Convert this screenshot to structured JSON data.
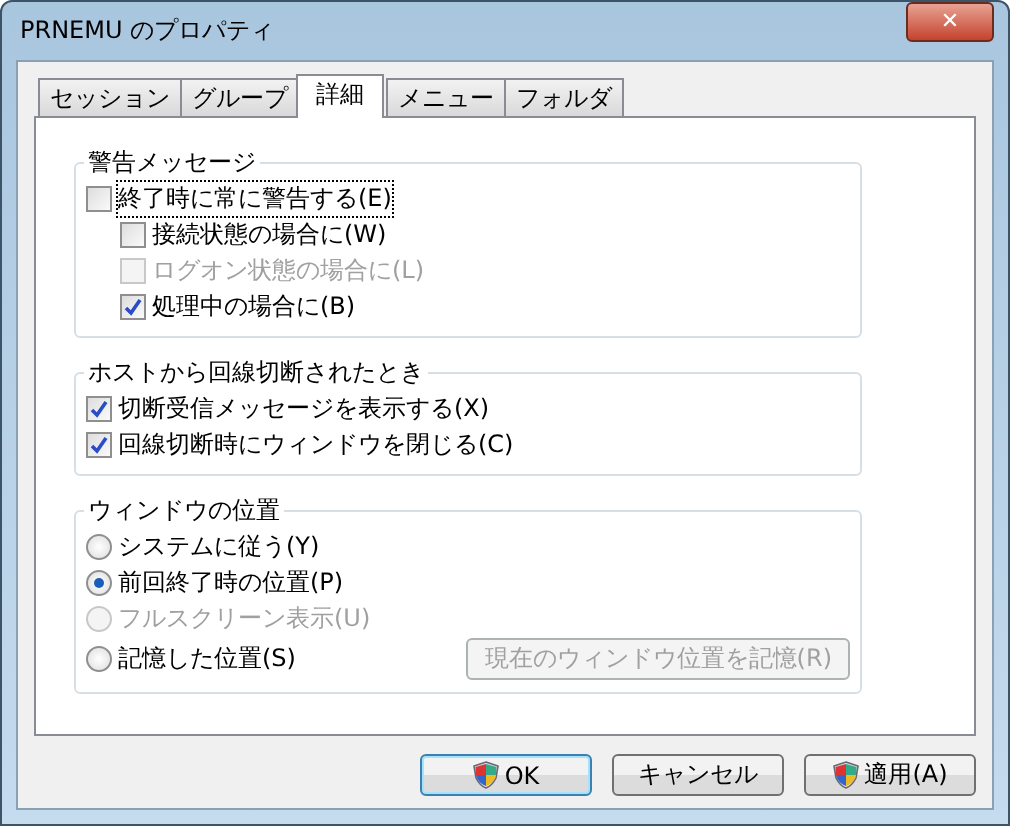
{
  "window": {
    "title": "PRNEMU のプロパティ",
    "close": "✕"
  },
  "tabs": [
    {
      "label": "セッション",
      "selected": false
    },
    {
      "label": "グループ",
      "selected": false
    },
    {
      "label": "詳細",
      "selected": true
    },
    {
      "label": "メニュー",
      "selected": false
    },
    {
      "label": "フォルダ",
      "selected": false
    }
  ],
  "groups": [
    {
      "title": "警告メッセージ",
      "kind": "checks",
      "items": [
        {
          "label": "終了時に常に警告する(E)",
          "checked": false,
          "disabled": false,
          "focused": true,
          "children": [
            {
              "label": "接続状態の場合に(W)",
              "checked": false,
              "disabled": false
            },
            {
              "label": "ログオン状態の場合に(L)",
              "checked": false,
              "disabled": true
            },
            {
              "label": "処理中の場合に(B)",
              "checked": true,
              "disabled": false
            }
          ]
        }
      ]
    },
    {
      "title": "ホストから回線切断されたとき",
      "kind": "checks",
      "items": [
        {
          "label": "切断受信メッセージを表示する(X)",
          "checked": true,
          "disabled": false
        },
        {
          "label": "回線切断時にウィンドウを閉じる(C)",
          "checked": true,
          "disabled": false
        }
      ]
    },
    {
      "title": "ウィンドウの位置",
      "kind": "radios",
      "items": [
        {
          "label": "システムに従う(Y)",
          "selected": false,
          "disabled": false
        },
        {
          "label": "前回終了時の位置(P)",
          "selected": true,
          "disabled": false
        },
        {
          "label": "フルスクリーン表示(U)",
          "selected": false,
          "disabled": true
        },
        {
          "label": "記憶した位置(S)",
          "selected": false,
          "disabled": false
        }
      ],
      "button": {
        "label": "現在のウィンドウ位置を記憶(R)",
        "disabled": true
      }
    }
  ],
  "buttons": [
    {
      "label": "OK",
      "shield": true,
      "default": true
    },
    {
      "label": "キャンセル",
      "shield": false,
      "default": false
    },
    {
      "label": "適用(A)",
      "shield": true,
      "default": false
    }
  ]
}
